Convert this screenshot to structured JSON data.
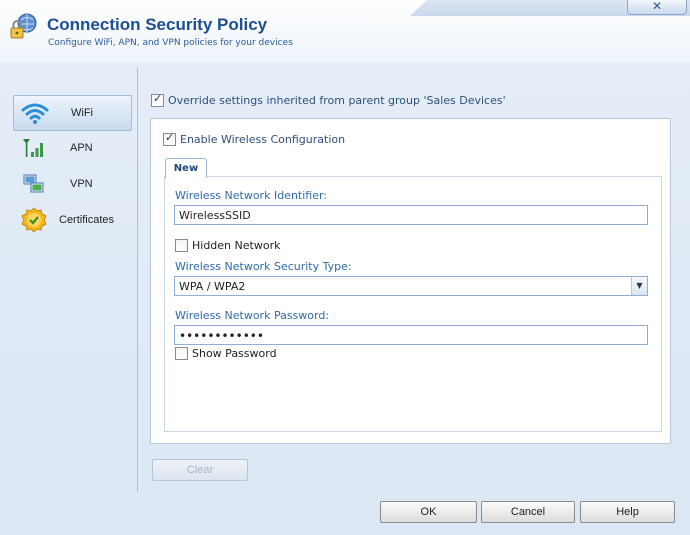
{
  "header": {
    "title": "Connection Security Policy",
    "subtitle": "Configure WiFi, APN, and VPN policies for your devices",
    "close_label": "✕"
  },
  "sidebar": {
    "items": [
      {
        "label": "WiFi",
        "icon": "wifi-icon",
        "active": true
      },
      {
        "label": "APN",
        "icon": "signal-bars-icon",
        "active": false
      },
      {
        "label": "VPN",
        "icon": "vpn-icon",
        "active": false
      },
      {
        "label": "Certificates",
        "icon": "certificate-icon",
        "active": false
      }
    ]
  },
  "main": {
    "override_label": "Override settings inherited from parent group 'Sales Devices'",
    "override_checked": true,
    "enable_label": "Enable Wireless Configuration",
    "enable_checked": true,
    "tab_label": "New",
    "ssid_label": "Wireless Network Identifier:",
    "ssid_value": "WirelessSSID",
    "hidden_label": "Hidden Network",
    "hidden_checked": false,
    "security_label": "Wireless Network Security Type:",
    "security_value": "WPA / WPA2",
    "password_label": "Wireless Network Password:",
    "password_value": "••••••••••••",
    "show_password_label": "Show Password",
    "show_password_checked": false,
    "clear_label": "Clear"
  },
  "footer": {
    "ok_label": "OK",
    "cancel_label": "Cancel",
    "help_label": "Help"
  },
  "colors": {
    "accent": "#1d4f91",
    "field_label": "#2f6aa8",
    "background": "#dfe9f5"
  }
}
